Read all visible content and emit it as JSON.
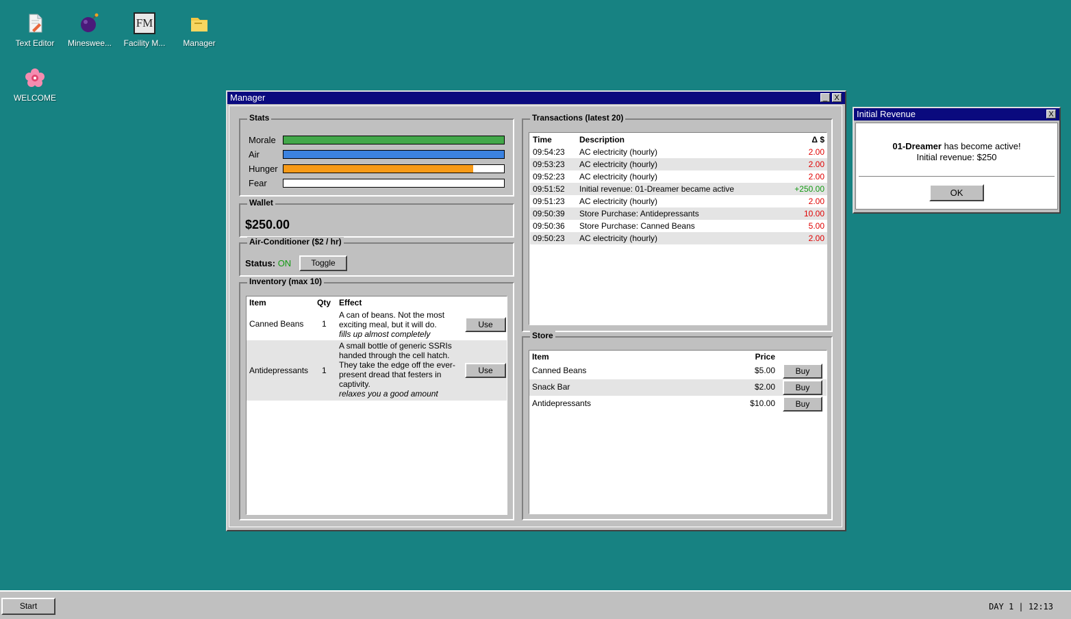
{
  "desktop": {
    "icons": [
      {
        "label": "Text Editor",
        "icon": "text-editor-icon"
      },
      {
        "label": "Mineswee...",
        "icon": "minesweeper-bomb-icon"
      },
      {
        "label": "Facility M...",
        "icon": "facility-manager-icon",
        "glyph_text": "FM"
      },
      {
        "label": "Manager",
        "icon": "folder-icon"
      },
      {
        "label": "WELCOME",
        "icon": "flower-icon"
      }
    ]
  },
  "manager": {
    "title": "Manager",
    "minimize": "_",
    "close": "X",
    "stats": {
      "title": "Stats",
      "items": [
        {
          "label": "Morale",
          "value": 1.0,
          "color": "#43a84a"
        },
        {
          "label": "Air",
          "value": 1.0,
          "color": "#3b82e0"
        },
        {
          "label": "Hunger",
          "value": 0.86,
          "color": "#f79a17"
        },
        {
          "label": "Fear",
          "value": 0.0,
          "color": "#e02020"
        }
      ]
    },
    "wallet": {
      "title": "Wallet",
      "amount": "$250.00"
    },
    "ac": {
      "title": "Air-Conditioner ($2 / hr)",
      "status_label": "Status:",
      "status_value": "ON",
      "status_color": "#119911",
      "toggle": "Toggle"
    },
    "inventory": {
      "title": "Inventory (max 10)",
      "headers": {
        "item": "Item",
        "qty": "Qty",
        "effect": "Effect"
      },
      "rows": [
        {
          "item": "Canned Beans",
          "qty": "1",
          "effect": "A can of beans. Not the most exciting meal, but it will do.",
          "note": "fills up almost completely",
          "action": "Use"
        },
        {
          "item": "Antidepressants",
          "qty": "1",
          "effect": "A small bottle of generic SSRIs handed through the cell hatch. They take the edge off the ever-present dread that festers in captivity.",
          "note": "relaxes you a good amount",
          "action": "Use"
        }
      ]
    },
    "transactions": {
      "title": "Transactions (latest 20)",
      "headers": {
        "time": "Time",
        "desc": "Description",
        "delta": "Δ $"
      },
      "rows": [
        {
          "time": "09:54:23",
          "desc": "AC electricity (hourly)",
          "delta": "2.00",
          "sign": "neg"
        },
        {
          "time": "09:53:23",
          "desc": "AC electricity (hourly)",
          "delta": "2.00",
          "sign": "neg"
        },
        {
          "time": "09:52:23",
          "desc": "AC electricity (hourly)",
          "delta": "2.00",
          "sign": "neg"
        },
        {
          "time": "09:51:52",
          "desc": "Initial revenue: 01-Dreamer became active",
          "delta": "+250.00",
          "sign": "pos"
        },
        {
          "time": "09:51:23",
          "desc": "AC electricity (hourly)",
          "delta": "2.00",
          "sign": "neg"
        },
        {
          "time": "09:50:39",
          "desc": "Store Purchase: Antidepressants",
          "delta": "10.00",
          "sign": "neg"
        },
        {
          "time": "09:50:36",
          "desc": "Store Purchase: Canned Beans",
          "delta": "5.00",
          "sign": "neg"
        },
        {
          "time": "09:50:23",
          "desc": "AC electricity (hourly)",
          "delta": "2.00",
          "sign": "neg"
        }
      ]
    },
    "store": {
      "title": "Store",
      "headers": {
        "item": "Item",
        "price": "Price"
      },
      "rows": [
        {
          "item": "Canned Beans",
          "price": "$5.00",
          "action": "Buy"
        },
        {
          "item": "Snack Bar",
          "price": "$2.00",
          "action": "Buy"
        },
        {
          "item": "Antidepressants",
          "price": "$10.00",
          "action": "Buy"
        }
      ]
    }
  },
  "dialog": {
    "title": "Initial Revenue",
    "close": "X",
    "name": "01-Dreamer",
    "message_rest": " has become active!",
    "line2": "Initial revenue: $250",
    "ok": "OK"
  },
  "taskbar": {
    "start": "Start",
    "clock": "DAY 1 | 12:13"
  }
}
